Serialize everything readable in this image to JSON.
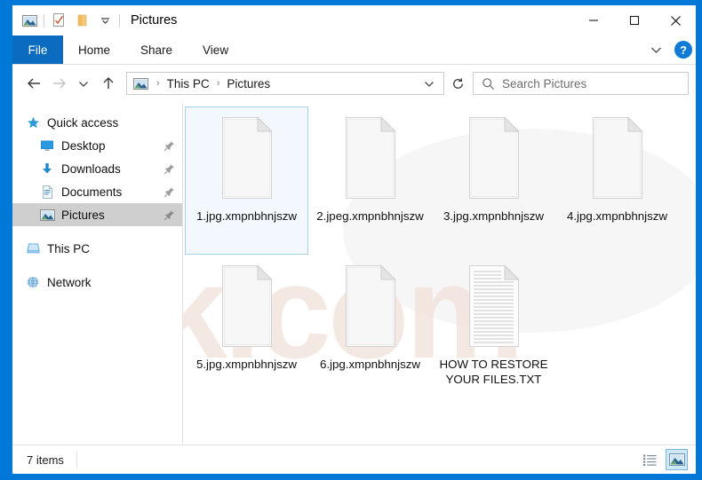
{
  "window": {
    "title": "Pictures",
    "quick_access_icons": [
      "pictures-icon",
      "properties-icon",
      "new-folder-icon",
      "customize-qat-chevron-icon"
    ],
    "controls": {
      "minimize": "minimize-icon",
      "maximize": "maximize-icon",
      "close": "close-icon"
    }
  },
  "ribbon": {
    "file_tab": "File",
    "tabs": [
      "Home",
      "Share",
      "View"
    ],
    "expand_icon": "chevron-down-icon",
    "help_label": "?"
  },
  "address_bar": {
    "back": "back-arrow-icon",
    "forward": "forward-arrow-icon",
    "recent": "chevron-down-icon",
    "up": "up-arrow-icon",
    "location_icon": "pictures-icon",
    "breadcrumbs": [
      "This PC",
      "Pictures"
    ],
    "separator": "›",
    "dropdown": "chevron-down-icon",
    "refresh": "refresh-icon"
  },
  "search": {
    "icon": "search-icon",
    "placeholder": "Search Pictures",
    "value": ""
  },
  "sidebar": {
    "items": [
      {
        "label": "Quick access",
        "icon": "star-icon",
        "level": "root",
        "pinned": false,
        "selected": false
      },
      {
        "label": "Desktop",
        "icon": "desktop-icon",
        "level": "child",
        "pinned": true,
        "selected": false
      },
      {
        "label": "Downloads",
        "icon": "downloads-icon",
        "level": "child",
        "pinned": true,
        "selected": false
      },
      {
        "label": "Documents",
        "icon": "documents-icon",
        "level": "child",
        "pinned": true,
        "selected": false
      },
      {
        "label": "Pictures",
        "icon": "pictures-icon",
        "level": "child",
        "pinned": true,
        "selected": true
      },
      {
        "label": "This PC",
        "icon": "this-pc-icon",
        "level": "root",
        "pinned": false,
        "selected": false
      },
      {
        "label": "Network",
        "icon": "network-icon",
        "level": "root",
        "pinned": false,
        "selected": false
      }
    ]
  },
  "files": [
    {
      "name": "1.jpg.xmpnbhnjszw",
      "icon": "blank-file-icon",
      "selected": true
    },
    {
      "name": "2.jpeg.xmpnbhnjszw",
      "icon": "blank-file-icon",
      "selected": false
    },
    {
      "name": "3.jpg.xmpnbhnjszw",
      "icon": "blank-file-icon",
      "selected": false
    },
    {
      "name": "4.jpg.xmpnbhnjszw",
      "icon": "blank-file-icon",
      "selected": false
    },
    {
      "name": "5.jpg.xmpnbhnjszw",
      "icon": "blank-file-icon",
      "selected": false
    },
    {
      "name": "6.jpg.xmpnbhnjszw",
      "icon": "blank-file-icon",
      "selected": false
    },
    {
      "name": "HOW TO RESTORE YOUR FILES.TXT",
      "icon": "text-file-icon",
      "selected": false
    }
  ],
  "status_bar": {
    "item_count": "7 items",
    "views": [
      {
        "name": "details-view",
        "icon": "details-view-icon",
        "active": false
      },
      {
        "name": "large-icons-view",
        "icon": "large-icons-view-icon",
        "active": true
      }
    ]
  },
  "watermark": {
    "text": "risk.com"
  },
  "colors": {
    "frame": "#0078d7",
    "file_tab": "#0b6cbf",
    "selection_bg": "#f2f8fd",
    "selection_border": "#a8cfe8",
    "nav_selected": "#cfcfcf",
    "help_blue": "#0f7bd4"
  }
}
